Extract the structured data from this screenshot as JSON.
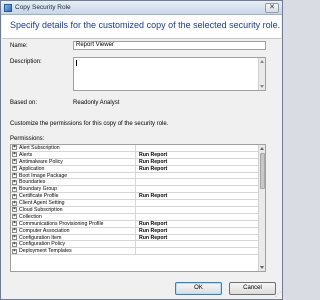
{
  "window": {
    "title": "Copy Security Role",
    "close_glyph": "✕"
  },
  "header": {
    "text": "Specify details for the customized copy of the selected security role."
  },
  "form": {
    "name_label": "Name:",
    "name_value": "Report Viewer",
    "description_label": "Description:",
    "description_value": "",
    "based_on_label": "Based on:",
    "based_on_value": "Readonly Analyst",
    "customize_text": "Customize the permissions for this copy of the security role."
  },
  "permissions": {
    "label": "Permissions:",
    "rows": [
      {
        "name": "Alert Subscription",
        "value": ""
      },
      {
        "name": "Alerts",
        "value": "Run Report"
      },
      {
        "name": "Antimalware Policy",
        "value": "Run Report"
      },
      {
        "name": "Application",
        "value": "Run Report"
      },
      {
        "name": "Boot Image Package",
        "value": ""
      },
      {
        "name": "Boundaries",
        "value": ""
      },
      {
        "name": "Boundary Group",
        "value": ""
      },
      {
        "name": "Certificate Profile",
        "value": "Run Report"
      },
      {
        "name": "Client Agent Setting",
        "value": ""
      },
      {
        "name": "Cloud Subscription",
        "value": ""
      },
      {
        "name": "Collection",
        "value": ""
      },
      {
        "name": "Communications Provisioning Profile",
        "value": "Run Report"
      },
      {
        "name": "Computer Association",
        "value": "Run Report"
      },
      {
        "name": "Configuration Item",
        "value": "Run Report"
      },
      {
        "name": "Configuration Policy",
        "value": ""
      },
      {
        "name": "Deployment Templates",
        "value": ""
      }
    ]
  },
  "buttons": {
    "ok": "OK",
    "cancel": "Cancel"
  },
  "icons": {
    "expander": "+",
    "grip": "⋰"
  }
}
